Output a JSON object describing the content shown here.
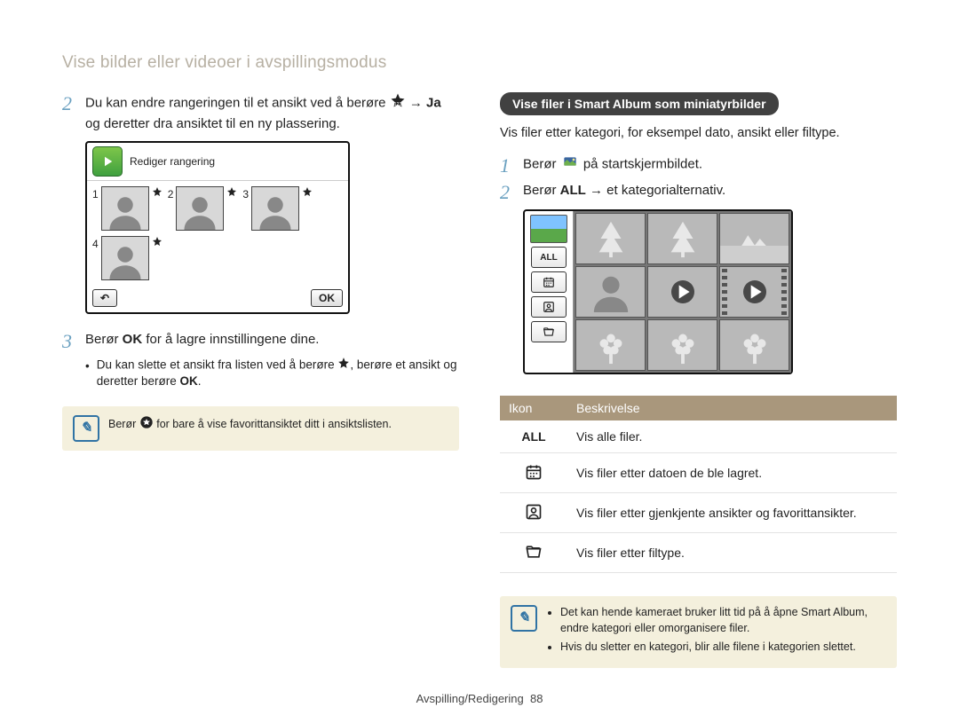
{
  "header": {
    "title": "Vise bilder eller videoer i avspillingsmodus"
  },
  "left": {
    "step2_a": "Du kan endre rangeringen til et ansikt ved å berøre",
    "step2_b": "→",
    "step2_ja": "Ja",
    "step2_c": "og deretter dra ansiktet til en ny plassering.",
    "device": {
      "title": "Rediger rangering",
      "back": "↶",
      "ok": "OK"
    },
    "step3_a": "Berør",
    "step3_ok": "OK",
    "step3_b": "for å lagre innstillingene dine.",
    "bullet_a": "Du kan slette et ansikt fra listen ved å berøre",
    "bullet_b": ", berøre et ansikt og deretter berøre",
    "bullet_ok": "OK",
    "bullet_c": ".",
    "tip_a": "Berør",
    "tip_b": "for bare å vise favorittansiktet ditt i ansiktslisten."
  },
  "right": {
    "heading": "Vise filer i Smart Album som miniatyrbilder",
    "intro": "Vis filer etter kategori, for eksempel dato, ansikt eller filtype.",
    "step1_a": "Berør",
    "step1_b": "på startskjermbildet.",
    "step2_a": "Berør",
    "step2_all": "ALL",
    "step2_b": "→ et kategorialternativ.",
    "sidebar_all": "ALL",
    "table": {
      "h1": "Ikon",
      "h2": "Beskrivelse",
      "rows": [
        {
          "icon": "ALL",
          "desc": "Vis alle filer."
        },
        {
          "icon": "calendar",
          "desc": "Vis filer etter datoen de ble lagret."
        },
        {
          "icon": "face",
          "desc": "Vis filer etter gjenkjente ansikter og favorittansikter."
        },
        {
          "icon": "file",
          "desc": "Vis filer etter filtype."
        }
      ]
    },
    "tips": [
      "Det kan hende kameraet bruker litt tid på å åpne Smart Album, endre kategori eller omorganisere filer.",
      "Hvis du sletter en kategori, blir alle filene i kategorien slettet."
    ]
  },
  "footer": {
    "section": "Avspilling/Redigering",
    "page": "88"
  }
}
